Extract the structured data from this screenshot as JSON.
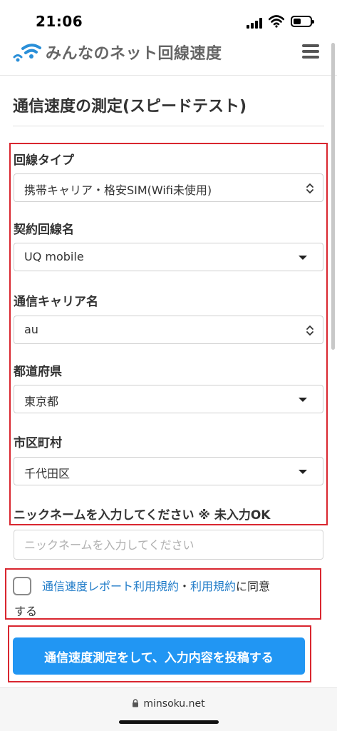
{
  "status_bar": {
    "time": "21:06",
    "battery_level": 0.45
  },
  "header": {
    "site_name": "みんなのネット回線速度",
    "menu_icon": "hamburger-icon",
    "logo_icon": "wifi-logo-icon"
  },
  "page": {
    "title": "通信速度の測定(スピードテスト)"
  },
  "form": {
    "line_type": {
      "label": "回線タイプ",
      "value": "携帯キャリア・格安SIM(Wifi未使用)"
    },
    "contract_line": {
      "label": "契約回線名",
      "value": "UQ mobile"
    },
    "carrier": {
      "label": "通信キャリア名",
      "value": "au"
    },
    "prefecture": {
      "label": "都道府県",
      "value": "東京都"
    },
    "city": {
      "label": "市区町村",
      "value": "千代田区"
    },
    "nickname": {
      "label": "ニックネームを入力してください ※ 未入力OK",
      "placeholder": "ニックネームを入力してください",
      "value": ""
    }
  },
  "agreement": {
    "link_report_terms": "通信速度レポート利用規約",
    "separator": "・",
    "link_terms": "利用規約",
    "suffix": "に同意",
    "line2": "する"
  },
  "submit": {
    "label": "通信速度測定をして、入力内容を投稿する"
  },
  "browser": {
    "url": "minsoku.net"
  },
  "colors": {
    "accent": "#2196f3",
    "link": "#1f7bc8",
    "highlight": "#d9262f"
  }
}
